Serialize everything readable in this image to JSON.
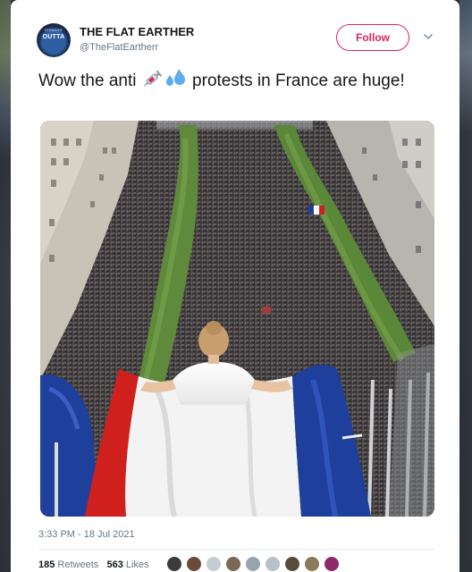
{
  "author": {
    "name": "THE FLAT EARTHER",
    "handle": "@TheFlatEartherr",
    "avatar_text": "OUTTA",
    "avatar_subtext": "STRAIGHT"
  },
  "follow_label": "Follow",
  "menu_icon": "chevron-down-icon",
  "tweet": {
    "text_before": "Wow the anti ",
    "emoji": [
      "syringe",
      "sweat-droplets"
    ],
    "text_after": " protests in France are huge!"
  },
  "timestamp": "3:33 PM - 18 Jul 2021",
  "stats": {
    "retweets_count": "185",
    "retweets_label": "Retweets",
    "likes_count": "563",
    "likes_label": "Likes"
  },
  "liker_colors": [
    "#3b3b3b",
    "#6b4a3a",
    "#c7ccd3",
    "#7a6a55",
    "#9aa4b0",
    "#b8c0c9",
    "#5a4a3a",
    "#8a7a5a",
    "#8c2a6a"
  ],
  "colors": {
    "follow_accent": "#e0245e",
    "flag_blue": "#1f3f9c",
    "flag_red": "#d0201d"
  }
}
